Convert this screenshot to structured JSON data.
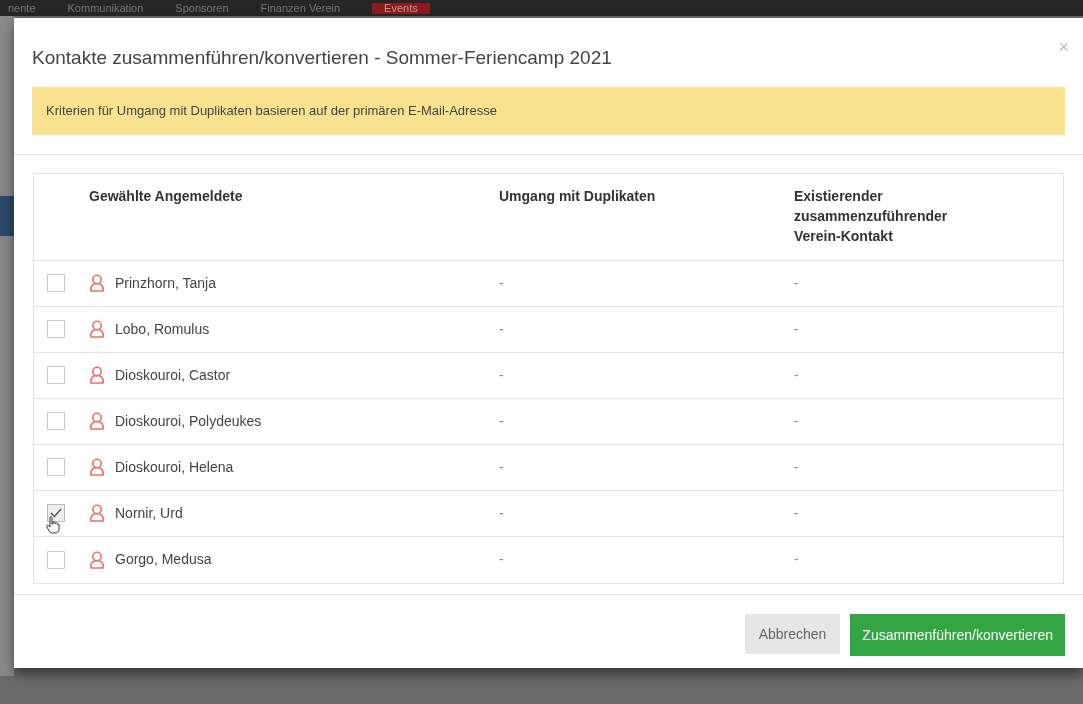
{
  "background_nav": [
    {
      "label": "nente",
      "selected": false
    },
    {
      "label": "Kommunikation",
      "selected": false
    },
    {
      "label": "Sponsoren",
      "selected": false
    },
    {
      "label": "Finanzen Verein",
      "selected": false
    },
    {
      "label": "Events",
      "selected": true
    }
  ],
  "dialog": {
    "title": "Kontakte zusammenführen/konvertieren - Sommer-Feriencamp 2021",
    "close": "×",
    "alert": "Kriterien für Umgang mit Duplikaten basieren auf der primären E-Mail-Adresse",
    "table": {
      "columns": [
        "Gewählte Angemeldete",
        "Umgang mit Duplikaten",
        "Existierender zusammenzuführender Verein-Kontakt"
      ],
      "rows": [
        {
          "checked": false,
          "name": "Prinzhorn, Tanja",
          "duplicates": "-",
          "existing": "-"
        },
        {
          "checked": false,
          "name": "Lobo, Romulus",
          "duplicates": "-",
          "existing": "-"
        },
        {
          "checked": false,
          "name": "Dioskouroi, Castor",
          "duplicates": "-",
          "existing": "-"
        },
        {
          "checked": false,
          "name": "Dioskouroi, Polydeukes",
          "duplicates": "-",
          "existing": "-"
        },
        {
          "checked": false,
          "name": "Dioskouroi, Helena",
          "duplicates": "-",
          "existing": "-"
        },
        {
          "checked": true,
          "name": "Nornir, Urd",
          "duplicates": "-",
          "existing": "-"
        },
        {
          "checked": false,
          "name": "Gorgo, Medusa",
          "duplicates": "-",
          "existing": "-"
        }
      ]
    },
    "buttons": [
      {
        "kind": "secondary",
        "label": "Abbrechen"
      },
      {
        "kind": "primary",
        "label": "Zusammenführen/konvertieren"
      }
    ]
  }
}
